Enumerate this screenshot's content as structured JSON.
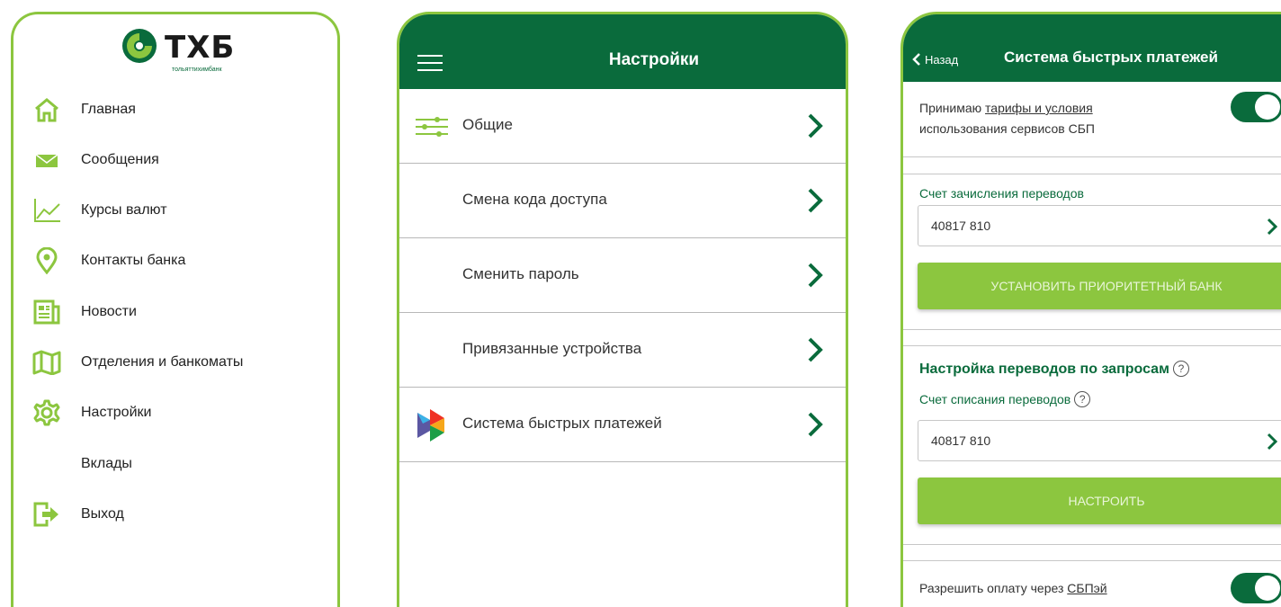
{
  "colors": {
    "brand_green": "#0a6b3c",
    "accent_green": "#8cc63f"
  },
  "menu": {
    "logo_text": "ТХБ",
    "logo_subtext": "тольяттихимбанк",
    "items": [
      {
        "label": "Главная",
        "icon": "home-icon"
      },
      {
        "label": "Сообщения",
        "icon": "envelope-icon"
      },
      {
        "label": "Курсы валют",
        "icon": "chart-icon"
      },
      {
        "label": "Контакты банка",
        "icon": "location-pin-icon"
      },
      {
        "label": "Новости",
        "icon": "newspaper-icon"
      },
      {
        "label": "Отделения и банкоматы",
        "icon": "map-icon"
      },
      {
        "label": "Настройки",
        "icon": "gear-icon"
      },
      {
        "label": "Вклады",
        "icon": ""
      },
      {
        "label": "Выход",
        "icon": "exit-icon"
      }
    ]
  },
  "settings": {
    "title": "Настройки",
    "rows": [
      {
        "label": "Общие",
        "icon": "sliders-icon"
      },
      {
        "label": "Смена кода доступа",
        "icon": ""
      },
      {
        "label": "Сменить пароль",
        "icon": ""
      },
      {
        "label": "Привязанные устройства",
        "icon": ""
      },
      {
        "label": "Система быстрых платежей",
        "icon": "sbp-logo-icon"
      }
    ]
  },
  "sbp": {
    "back_label": "Назад",
    "title": "Система быстрых платежей",
    "accept_prefix": "Принимаю ",
    "accept_link": "тарифы и условия",
    "accept_line2": "использования сервисов СБП",
    "accept_toggle_on": true,
    "credit_account_label": "Счет зачисления переводов",
    "credit_account_value": "40817 810",
    "priority_bank_button": "УСТАНОВИТЬ ПРИОРИТЕТНЫЙ БАНК",
    "requests_title": "Настройка переводов по запросам",
    "debit_account_label": "Счет списания переводов",
    "debit_account_value": "40817 810",
    "configure_button": "НАСТРОИТЬ",
    "sbpay_prefix": "Разрешить оплату через ",
    "sbpay_link": "СБПэй",
    "sbpay_toggle_on": true,
    "help_glyph": "?"
  }
}
